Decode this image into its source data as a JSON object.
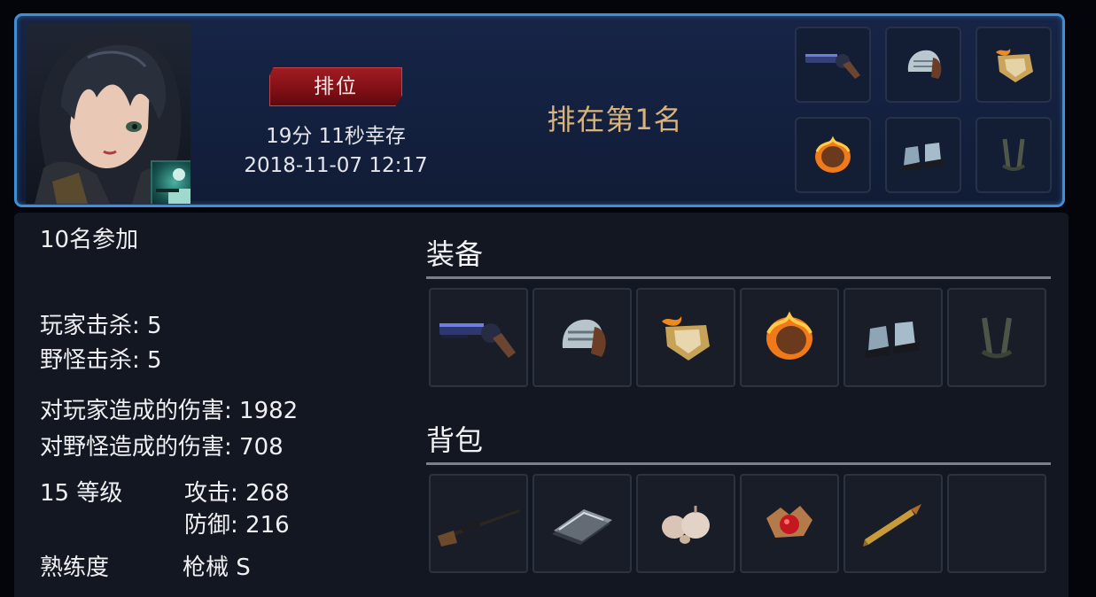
{
  "header": {
    "mode_label": "排位",
    "survival_time": "19分 11秒幸存",
    "match_datetime": "2018-11-07 12:17",
    "placement": "排在第1名"
  },
  "summary": {
    "participants": "10名参加"
  },
  "stats": {
    "player_kills": "玩家击杀: 5",
    "monster_kills": "野怪击杀: 5",
    "damage_to_players": "对玩家造成的伤害: 1982",
    "damage_to_monsters": "对野怪造成的伤害: 708",
    "level": "15 等级",
    "attack": "攻击: 268",
    "defense": "防御: 216",
    "proficiency_label": "熟练度",
    "proficiency_value": "枪械 S"
  },
  "sections": {
    "equipment_title": "装备",
    "bag_title": "背包"
  },
  "equipment": [
    {
      "icon": "revolver-icon"
    },
    {
      "icon": "helmet-icon"
    },
    {
      "icon": "flaming-shield-icon"
    },
    {
      "icon": "flaming-armor-icon"
    },
    {
      "icon": "boots-icon"
    },
    {
      "icon": "harness-icon"
    }
  ],
  "bag": [
    {
      "icon": "sniper-rifle-icon"
    },
    {
      "icon": "metal-plate-icon"
    },
    {
      "icon": "garlic-icon"
    },
    {
      "icon": "red-gem-icon"
    },
    {
      "icon": "bullet-icon"
    },
    {
      "icon": "empty-slot"
    }
  ],
  "colors": {
    "header_border": "#3f8fd6",
    "rank_button": "#8a131a",
    "placement_text": "#d8b47c",
    "panel_bg": "#121722"
  }
}
